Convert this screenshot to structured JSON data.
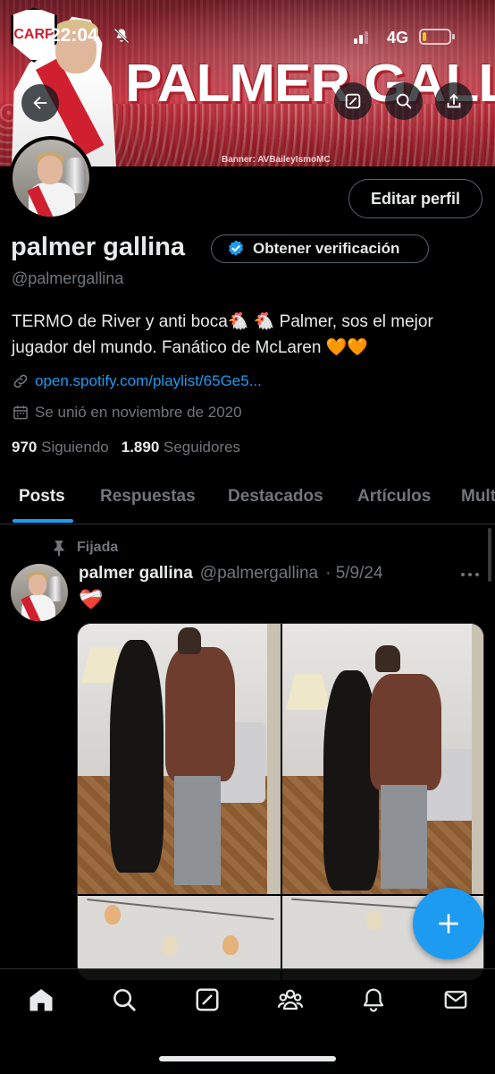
{
  "status_bar": {
    "time": "22:04",
    "network": "4G",
    "battery_level": 0.15,
    "icons": [
      "bell-mute-icon",
      "signal-icon",
      "battery-icon"
    ]
  },
  "banner": {
    "title": "PALMER GALLINA",
    "crest_text": "CARP",
    "credit": "Banner: AVBaileyIsmoMC"
  },
  "header_buttons": {
    "back": "back-arrow-icon",
    "grok": "grok-icon",
    "search": "search-icon",
    "share": "share-icon"
  },
  "profile": {
    "edit_label": "Editar perfil",
    "display_name": "palmer gallina",
    "verify_label": "Obtener verificación",
    "handle": "@palmergallina",
    "bio": "TERMO de River y anti boca🐔 🐔  Palmer, sos el mejor jugador del mundo. Fanático de McLaren 🧡🧡",
    "link": "open.spotify.com/playlist/65Ge5...",
    "joined": "Se unió en noviembre de 2020",
    "following_count": "970",
    "following_label": "Siguiendo",
    "followers_count": "1.890",
    "followers_label": "Seguidores"
  },
  "tabs": [
    {
      "label": "Posts",
      "active": true
    },
    {
      "label": "Respuestas",
      "active": false
    },
    {
      "label": "Destacados",
      "active": false
    },
    {
      "label": "Artículos",
      "active": false
    },
    {
      "label": "Multimedia",
      "active": false
    }
  ],
  "pinned_post": {
    "pinned_label": "Fijada",
    "author_name": "palmer gallina",
    "author_handle": "@palmergallina",
    "separator": "·",
    "date": "5/9/24",
    "text": "❤️‍🩹",
    "media_count": 4
  },
  "bottom_nav": [
    "home-icon",
    "search-icon",
    "grok-icon",
    "communities-icon",
    "notifications-icon",
    "messages-icon"
  ],
  "colors": {
    "accent": "#1d9bf0",
    "background": "#000000",
    "text_primary": "#e7e9ea",
    "text_secondary": "#71767b",
    "border": "#2f3336"
  }
}
